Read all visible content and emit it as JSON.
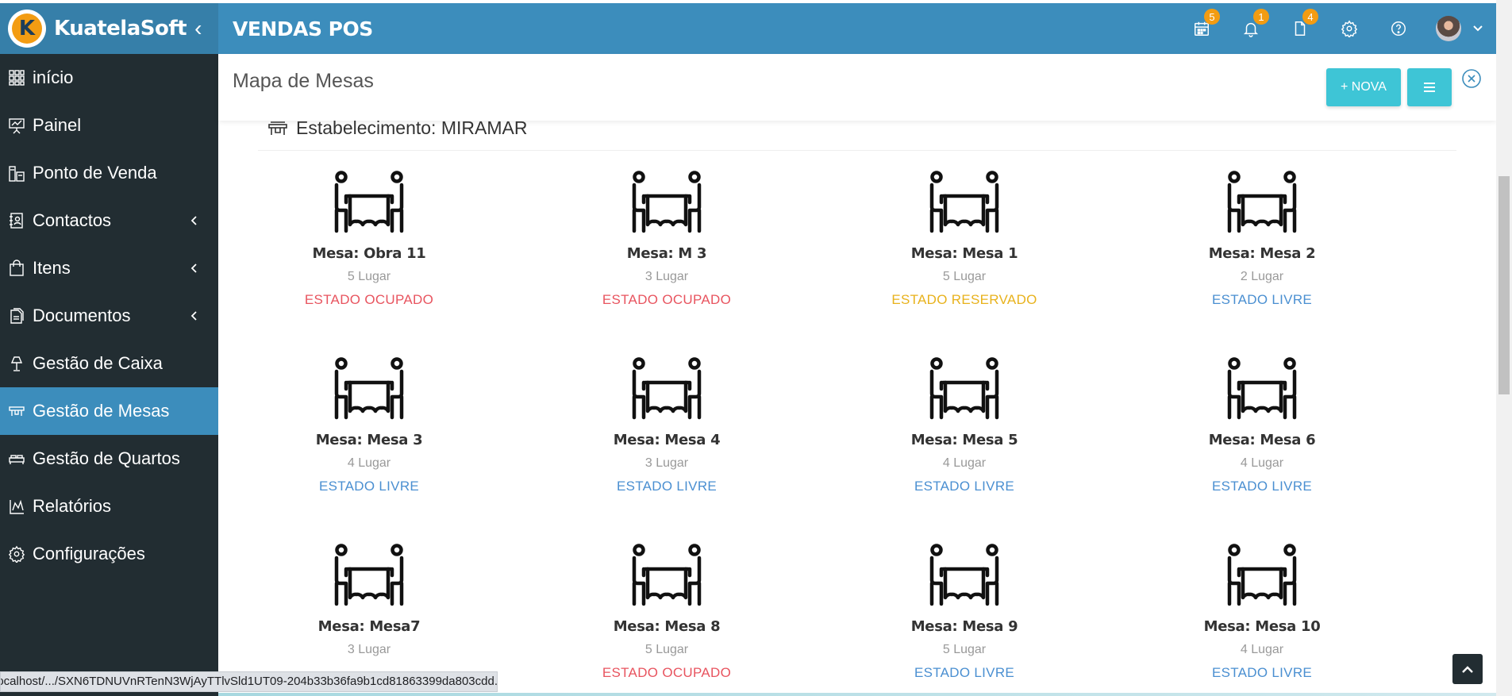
{
  "app": {
    "brand": "KuatelaSoft",
    "brand_logo_letter": "K",
    "module_title": "VENDAS POS"
  },
  "header_icons": [
    {
      "name": "calendar-icon",
      "badge": "5"
    },
    {
      "name": "bell-icon",
      "badge": "1"
    },
    {
      "name": "clipboard-icon",
      "badge": "4"
    },
    {
      "name": "gear-icon",
      "badge": ""
    },
    {
      "name": "help-icon",
      "badge": ""
    }
  ],
  "sidebar": {
    "items": [
      {
        "label": "início",
        "icon": "dashboard-grid-icon",
        "chevron": false,
        "active": false
      },
      {
        "label": "Painel",
        "icon": "presentation-board-icon",
        "chevron": false,
        "active": false
      },
      {
        "label": "Ponto de Venda",
        "icon": "pos-terminal-icon",
        "chevron": false,
        "active": false
      },
      {
        "label": "Contactos",
        "icon": "contact-book-icon",
        "chevron": true,
        "active": false
      },
      {
        "label": "Itens",
        "icon": "shopping-bag-icon",
        "chevron": true,
        "active": false
      },
      {
        "label": "Documentos",
        "icon": "documents-icon",
        "chevron": true,
        "active": false
      },
      {
        "label": "Gestão de Caixa",
        "icon": "lamp-icon",
        "chevron": false,
        "active": false
      },
      {
        "label": "Gestão de Mesas",
        "icon": "table-chairs-icon",
        "chevron": false,
        "active": true
      },
      {
        "label": "Gestão de Quartos",
        "icon": "bed-icon",
        "chevron": false,
        "active": false
      },
      {
        "label": "Relatórios",
        "icon": "report-chart-icon",
        "chevron": false,
        "active": false
      },
      {
        "label": "Configurações",
        "icon": "gear-icon",
        "chevron": false,
        "active": false
      }
    ]
  },
  "page": {
    "title": "Mapa de Mesas",
    "new_button": "+ NOVA",
    "establishment": "Estabelecimento: MIRAMAR"
  },
  "colors": {
    "ocupado": "#e8545f",
    "reservado": "#e8b21c",
    "livre": "#4a8fd1"
  },
  "tables": [
    {
      "name": "Mesa: Obra 11",
      "seats": "5 Lugar",
      "state": "ESTADO OCUPADO",
      "state_key": "ocupado"
    },
    {
      "name": "Mesa: M 3",
      "seats": "3 Lugar",
      "state": "ESTADO OCUPADO",
      "state_key": "ocupado"
    },
    {
      "name": "Mesa: Mesa 1",
      "seats": "5 Lugar",
      "state": "ESTADO RESERVADO",
      "state_key": "reservado"
    },
    {
      "name": "Mesa: Mesa 2",
      "seats": "2 Lugar",
      "state": "ESTADO LIVRE",
      "state_key": "livre"
    },
    {
      "name": "Mesa: Mesa 3",
      "seats": "4 Lugar",
      "state": "ESTADO LIVRE",
      "state_key": "livre"
    },
    {
      "name": "Mesa: Mesa 4",
      "seats": "3 Lugar",
      "state": "ESTADO LIVRE",
      "state_key": "livre"
    },
    {
      "name": "Mesa: Mesa 5",
      "seats": "4 Lugar",
      "state": "ESTADO LIVRE",
      "state_key": "livre"
    },
    {
      "name": "Mesa: Mesa 6",
      "seats": "4 Lugar",
      "state": "ESTADO LIVRE",
      "state_key": "livre"
    },
    {
      "name": "Mesa: Mesa7",
      "seats": "3 Lugar",
      "state": "",
      "state_key": "livre"
    },
    {
      "name": "Mesa: Mesa 8",
      "seats": "5 Lugar",
      "state": "ESTADO OCUPADO",
      "state_key": "ocupado"
    },
    {
      "name": "Mesa: Mesa 9",
      "seats": "5 Lugar",
      "state": "ESTADO LIVRE",
      "state_key": "livre"
    },
    {
      "name": "Mesa: Mesa 10",
      "seats": "4 Lugar",
      "state": "ESTADO LIVRE",
      "state_key": "livre"
    }
  ],
  "status_bar": {
    "url": "localhost/.../SXN6TDNUVnRTenN3WjAyTTlvSld1UT09-204b33b36fa9b1cd81863399da803cdd..."
  }
}
